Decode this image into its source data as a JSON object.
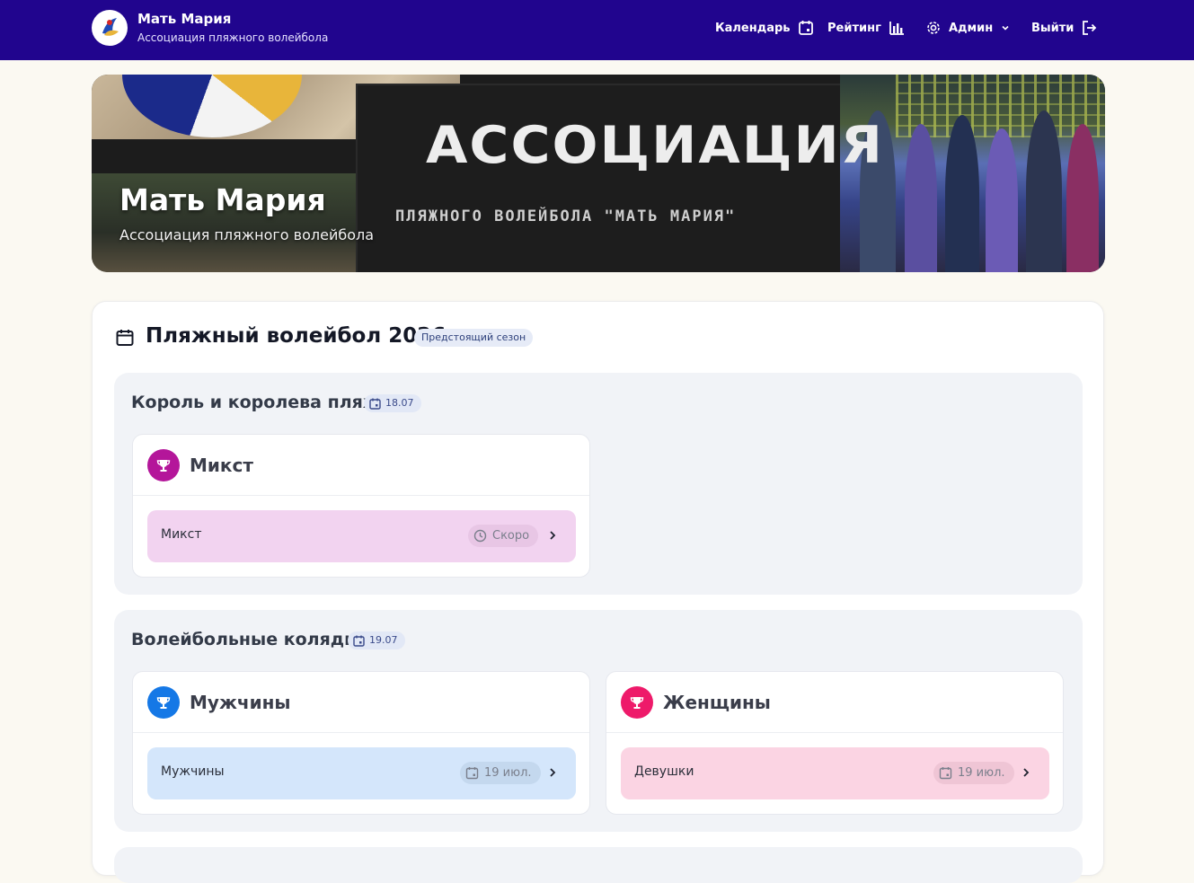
{
  "header": {
    "brand_title": "Мать Мария",
    "brand_subtitle": "Ассоциация пляжного волейбола",
    "nav": [
      {
        "label": "Календарь",
        "icon": "calendar-icon"
      },
      {
        "label": "Рейтинг",
        "icon": "bar-chart-icon"
      },
      {
        "label": "Админ",
        "icon": "gear-icon"
      },
      {
        "label": "Выйти",
        "icon": "logout-icon"
      }
    ],
    "bg_color": "#21058e"
  },
  "banner": {
    "title": "Мать Мария",
    "subtitle": "Ассоциация пляжного волейбола",
    "logo_big": "АССОЦИАЦИЯ",
    "logo_small": "ПЛЯЖНОГО ВОЛЕЙБОЛА \"МАТЬ МАРИЯ\""
  },
  "season": {
    "title": "Пляжный волейбол 2026",
    "badge": "Предстоящий сезон"
  },
  "tournaments": [
    {
      "title": "Король и королева пляжа",
      "date": "18.07",
      "categories": [
        {
          "name": "Микст",
          "icon_color": "#b4169a",
          "divisions": [
            {
              "name": "Микст",
              "status": "Скоро",
              "status_icon": "clock-icon",
              "row_color": "#f2d3f0"
            }
          ]
        }
      ]
    },
    {
      "title": "Волейбольные колядки",
      "date": "19.07",
      "categories": [
        {
          "name": "Мужчины",
          "icon_color": "#1578e6",
          "divisions": [
            {
              "name": "Мужчины",
              "status": "19 июл.",
              "status_icon": "calendar-icon",
              "row_color": "#d4e6fb"
            }
          ]
        },
        {
          "name": "Женщины",
          "icon_color": "#ee1a6a",
          "divisions": [
            {
              "name": "Девушки",
              "status": "19 июл.",
              "status_icon": "calendar-icon",
              "row_color": "#fbd4e3"
            }
          ]
        }
      ]
    }
  ]
}
